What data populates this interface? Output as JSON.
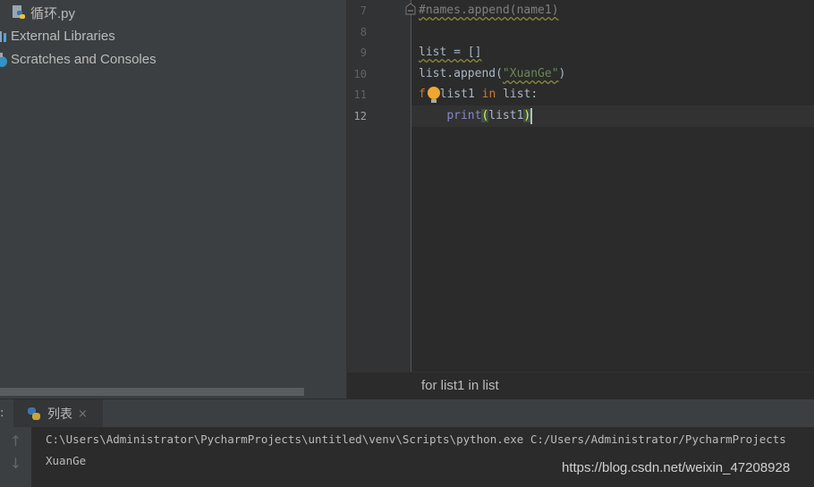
{
  "project_tree": {
    "items": [
      {
        "label": "循环.py",
        "icon": "python-file-icon"
      },
      {
        "label": "External Libraries",
        "icon": "library-icon"
      },
      {
        "label": "Scratches and Consoles",
        "icon": "scratches-icon"
      }
    ]
  },
  "editor": {
    "lines": [
      {
        "number": "7",
        "text": "#names.append(name1)"
      },
      {
        "number": "8",
        "text": ""
      },
      {
        "number": "9",
        "text": "list = []"
      },
      {
        "number": "10",
        "text": "list.append(\"XuanGe\")"
      },
      {
        "number": "11",
        "text": "for list1 in list:"
      },
      {
        "number": "12",
        "text": "    print(list1)"
      }
    ],
    "current_line": "12",
    "l7": "#names.append(name1)",
    "l9a": "list = []",
    "l10a": "list.append(",
    "l10s": "\"XuanGe\"",
    "l10b": ")",
    "l11a": "f",
    "l11b": " list1 ",
    "l11c": "in",
    "l11d": " list:",
    "l12a": "    ",
    "l12b": "print",
    "l12c": "(",
    "l12d": "list1",
    "l12e": ")"
  },
  "breadcrumb": "for list1 in list",
  "run_panel": {
    "prefix": ":",
    "tab_label": "列表",
    "close": "×",
    "output": [
      "C:\\Users\\Administrator\\PycharmProjects\\untitled\\venv\\Scripts\\python.exe C:/Users/Administrator/PycharmProjects",
      "XuanGe"
    ],
    "up": "↑",
    "down": "↓"
  },
  "watermark": "https://blog.csdn.net/weixin_47208928"
}
